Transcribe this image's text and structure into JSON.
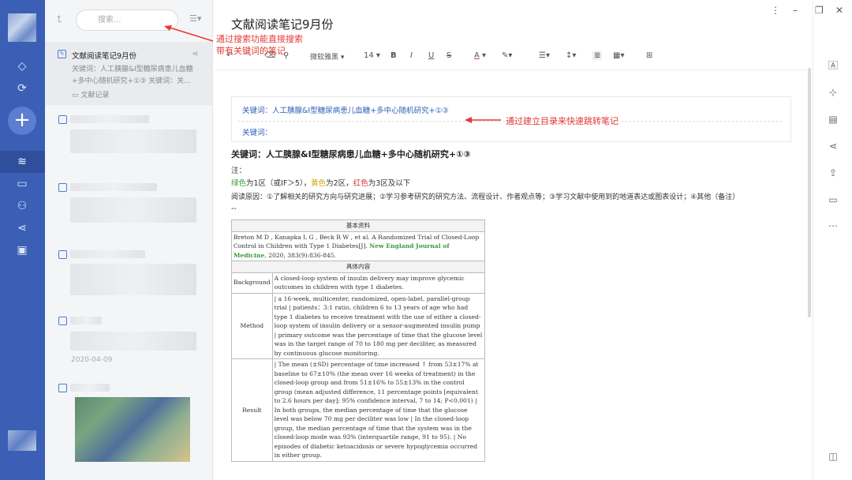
{
  "left_rail": {
    "plus_label": "+"
  },
  "note_list": {
    "search_placeholder": "搜索...",
    "active_note": {
      "title": "文献阅读笔记9月份",
      "preview": "关键词：人工胰腺&I型糖尿病患儿血糖+多中心随机研究+①③ 关键词：关...",
      "folder": "文献记录"
    },
    "date": "2020-04-09"
  },
  "editor": {
    "title": "文献阅读笔记9月份",
    "toolbar": {
      "font": "微软雅黑",
      "size": "14",
      "bold": "B",
      "italic": "I",
      "underline": "U",
      "strike": "S",
      "font_color": "A"
    },
    "toc": {
      "item1": "关键词：人工胰腺&I型糖尿病患儿血糖+多中心随机研究+①③",
      "item2": "关键词："
    },
    "heading": "关键词：人工胰腺&I型糖尿病患儿血糖+多中心随机研究+①③",
    "note_label": "注：",
    "zone_line": {
      "green": "绿色",
      "part1": "为1区（或IF＞5），",
      "yellow": "黄色",
      "part2": "为2区，",
      "red": "红色",
      "part3": "为3区及以下"
    },
    "reading_reason": "阅读原因：①了解相关的研究方向与研究进展；②学习参考研究的研究方法、流程设计、作者观点等；③学习文献中使用到的地道表达或图表设计；④其他（备注）",
    "dashes": "--",
    "table": {
      "basic_header": "基本资料",
      "citation_a": "Breton M D , Kanapka L G , Beck R W , et al. A Randomized Trial of Closed-Loop Control in Children with Type 1 Diabetes[J]. ",
      "journal": "New England Journal of Medicine",
      "citation_b": ", 2020, 383(9):836-845.",
      "detail_header": "具体内容",
      "rows": [
        {
          "label": "Background",
          "text": "A closed-loop system of insulin delivery may improve glycemic outcomes in children with type 1 diabetes."
        },
        {
          "label": "Method",
          "text": "| a 16-week, multicenter, randomized, open-label, parallel-group trial | patients：3:1 ratio, children 6 to 13 years of age who had type 1 diabetes to receive treatment with the use of either a closed-loop system of insulin delivery or a sensor-augmented insulin pump | primary outcome was the percentage of time that the glucose level was in the target range of 70 to 180 mg per deciliter, as measured by continuous glucose monitoring."
        },
        {
          "label": "Result",
          "text": "| The mean (±SD) percentage of time increased ↑ from 53±17% at baseline to 67±10% (the mean over 16 weeks of treatment) in the closed-loop group and from 51±16% to 55±13% in the control group (mean adjusted difference, 11 percentage points [equivalent to 2.6 hours per day]; 95% confidence interval, 7 to 14; P<0.001) | In both groups, the median percentage of time that the glucose level was below 70 mg per deciliter was low | In the closed-loop group, the median percentage of time that the system was in the closed-loop mode was 93% (interquartile range, 91 to 95). | No episodes of diabetic ketoacidosis or severe hypoglycemia occurred in either group."
        }
      ]
    }
  },
  "annotations": {
    "search_line1": "通过搜索功能直接搜索",
    "search_line2": "带有关键词的笔记",
    "toc_note": "通过建立目录来快速跳转笔记"
  },
  "colors": {
    "rail": "#3a5fb5",
    "accent_blue": "#2d5fb8",
    "annotation_red": "#e53935"
  }
}
